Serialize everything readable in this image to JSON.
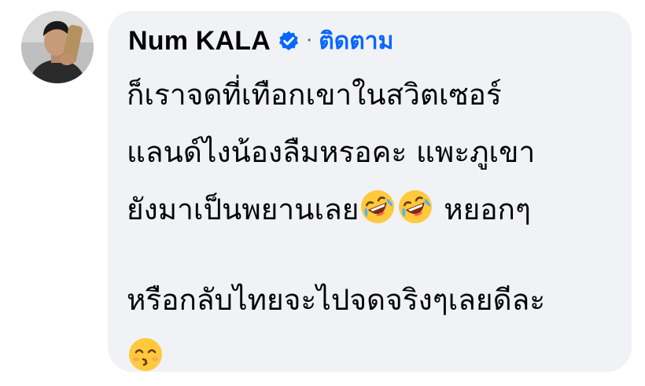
{
  "comment": {
    "author": "Num KALA",
    "verified_icon": "verified-badge-icon",
    "separator": "·",
    "follow_label": "ติดตาม",
    "lines": [
      "ก็เราจดที่เทือกเขาในสวิตเซอร์",
      "แลนด์ไงน้องลืมหรอคะ แพะภูเขา",
      "ยังมาเป็นพยานเลย",
      " หยอกๆ",
      "หรือกลับไทยจะไปจดจริงๆเลยดีละ"
    ],
    "emoji_names": [
      "rolling-on-floor-laughing-emoji",
      "kissing-smiling-eyes-emoji"
    ]
  },
  "colors": {
    "bubble": "#f0f2f5",
    "name": "#050505",
    "follow": "#0866ff",
    "verified": "#0866ff"
  }
}
